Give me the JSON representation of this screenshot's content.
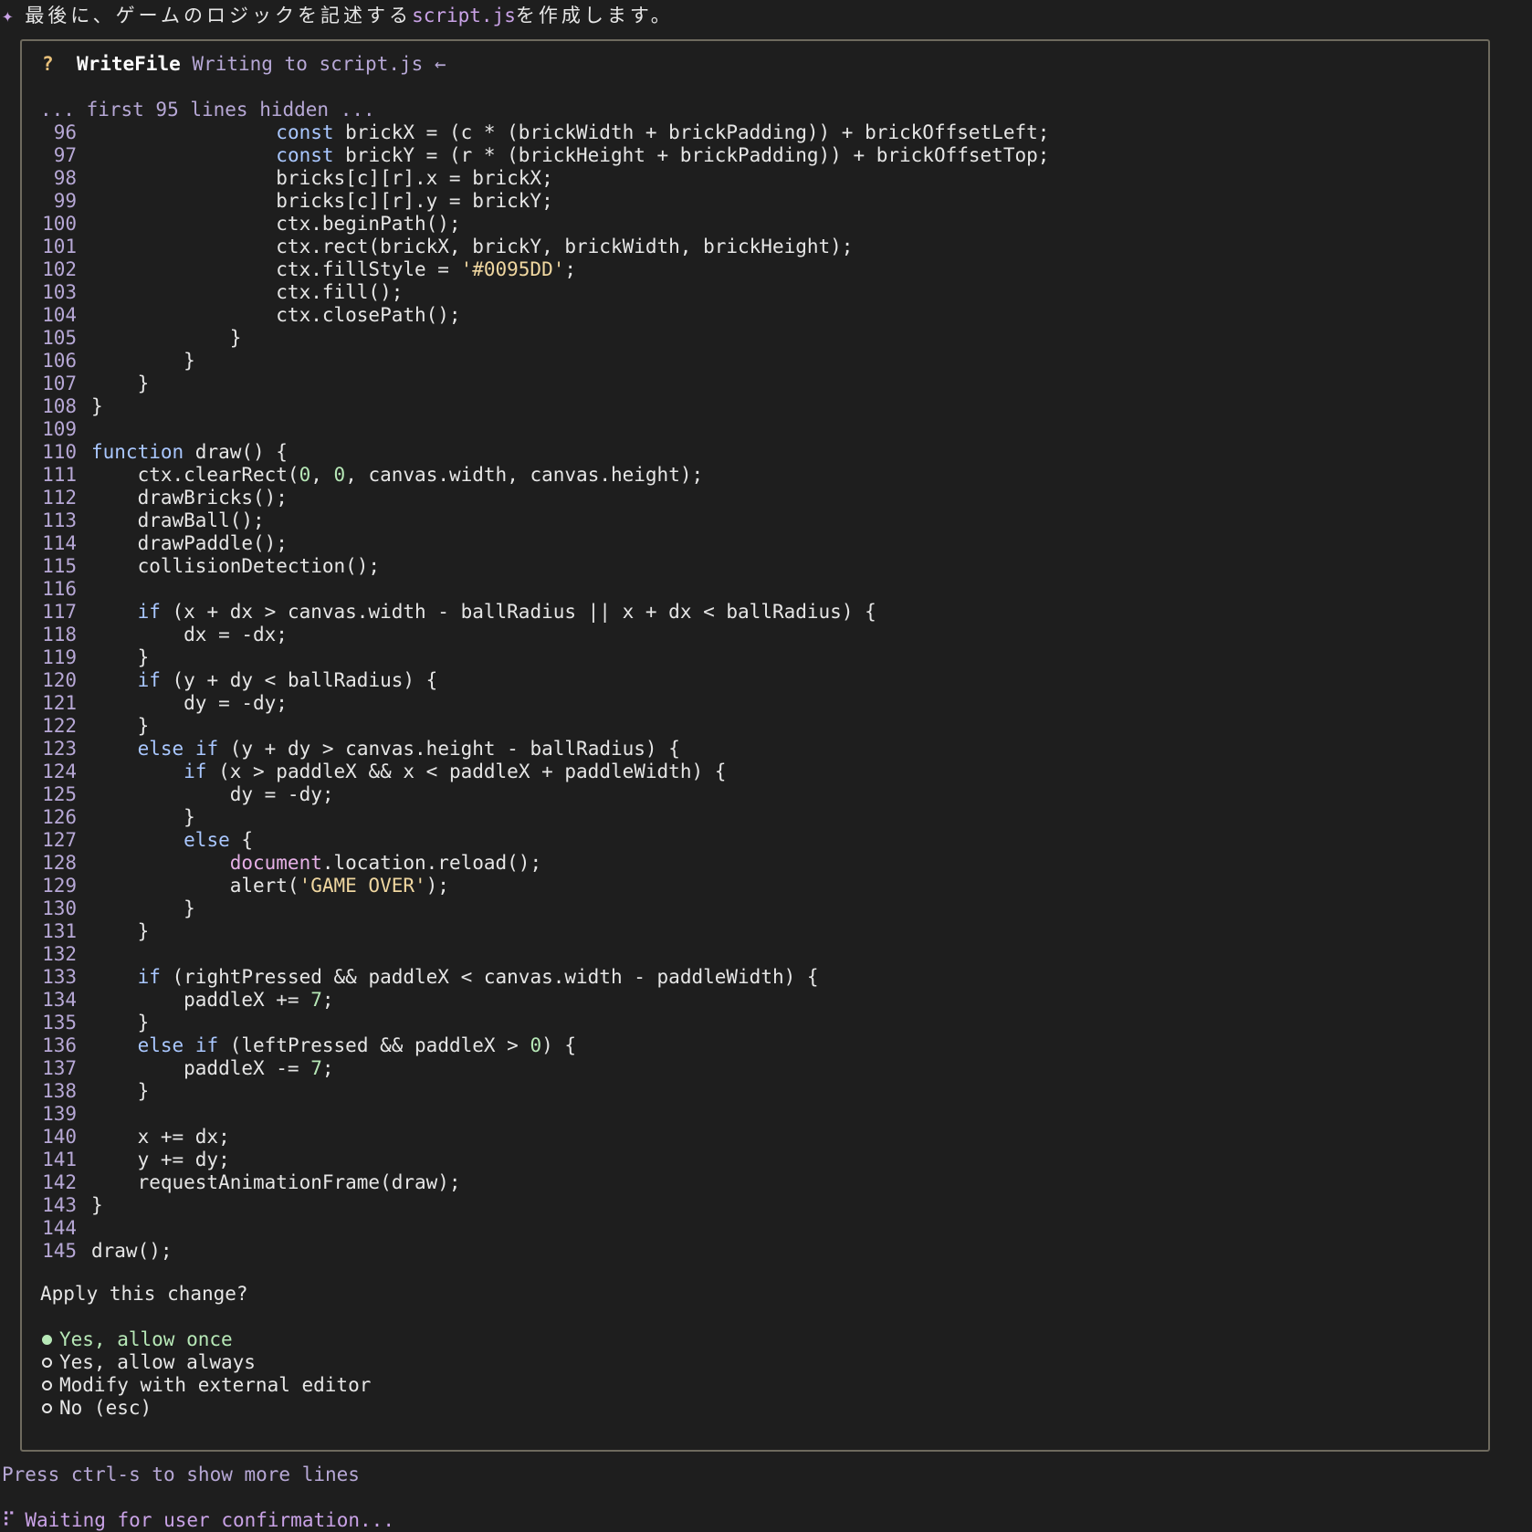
{
  "header": {
    "prefix": "最後に、ゲームのロジックを記述する",
    "file": "script.js",
    "suffix": "を作成します。"
  },
  "dialog": {
    "question_mark": "?",
    "tool_name": "WriteFile",
    "tool_desc": "Writing to script.js ←",
    "hidden_note": "... first 95 lines hidden ...",
    "apply_question": "Apply this change?",
    "options": [
      {
        "label": "Yes, allow once",
        "selected": true
      },
      {
        "label": "Yes, allow always",
        "selected": false
      },
      {
        "label": "Modify with external editor",
        "selected": false
      },
      {
        "label": "No (esc)",
        "selected": false
      }
    ]
  },
  "code_lines": [
    {
      "n": "96",
      "text": "                const brickX = (c * (brickWidth + brickPadding)) + brickOffsetLeft;"
    },
    {
      "n": "97",
      "text": "                const brickY = (r * (brickHeight + brickPadding)) + brickOffsetTop;"
    },
    {
      "n": "98",
      "text": "                bricks[c][r].x = brickX;"
    },
    {
      "n": "99",
      "text": "                bricks[c][r].y = brickY;"
    },
    {
      "n": "100",
      "text": "                ctx.beginPath();"
    },
    {
      "n": "101",
      "text": "                ctx.rect(brickX, brickY, brickWidth, brickHeight);"
    },
    {
      "n": "102",
      "text": "                ctx.fillStyle = '#0095DD';"
    },
    {
      "n": "103",
      "text": "                ctx.fill();"
    },
    {
      "n": "104",
      "text": "                ctx.closePath();"
    },
    {
      "n": "105",
      "text": "            }"
    },
    {
      "n": "106",
      "text": "        }"
    },
    {
      "n": "107",
      "text": "    }"
    },
    {
      "n": "108",
      "text": "}"
    },
    {
      "n": "109",
      "text": ""
    },
    {
      "n": "110",
      "text": "function draw() {"
    },
    {
      "n": "111",
      "text": "    ctx.clearRect(0, 0, canvas.width, canvas.height);"
    },
    {
      "n": "112",
      "text": "    drawBricks();"
    },
    {
      "n": "113",
      "text": "    drawBall();"
    },
    {
      "n": "114",
      "text": "    drawPaddle();"
    },
    {
      "n": "115",
      "text": "    collisionDetection();"
    },
    {
      "n": "116",
      "text": ""
    },
    {
      "n": "117",
      "text": "    if (x + dx > canvas.width - ballRadius || x + dx < ballRadius) {"
    },
    {
      "n": "118",
      "text": "        dx = -dx;"
    },
    {
      "n": "119",
      "text": "    }"
    },
    {
      "n": "120",
      "text": "    if (y + dy < ballRadius) {"
    },
    {
      "n": "121",
      "text": "        dy = -dy;"
    },
    {
      "n": "122",
      "text": "    }"
    },
    {
      "n": "123",
      "text": "    else if (y + dy > canvas.height - ballRadius) {"
    },
    {
      "n": "124",
      "text": "        if (x > paddleX && x < paddleX + paddleWidth) {"
    },
    {
      "n": "125",
      "text": "            dy = -dy;"
    },
    {
      "n": "126",
      "text": "        }"
    },
    {
      "n": "127",
      "text": "        else {"
    },
    {
      "n": "128",
      "text": "            document.location.reload();"
    },
    {
      "n": "129",
      "text": "            alert('GAME OVER');"
    },
    {
      "n": "130",
      "text": "        }"
    },
    {
      "n": "131",
      "text": "    }"
    },
    {
      "n": "132",
      "text": ""
    },
    {
      "n": "133",
      "text": "    if (rightPressed && paddleX < canvas.width - paddleWidth) {"
    },
    {
      "n": "134",
      "text": "        paddleX += 7;"
    },
    {
      "n": "135",
      "text": "    }"
    },
    {
      "n": "136",
      "text": "    else if (leftPressed && paddleX > 0) {"
    },
    {
      "n": "137",
      "text": "        paddleX -= 7;"
    },
    {
      "n": "138",
      "text": "    }"
    },
    {
      "n": "139",
      "text": ""
    },
    {
      "n": "140",
      "text": "    x += dx;"
    },
    {
      "n": "141",
      "text": "    y += dy;"
    },
    {
      "n": "142",
      "text": "    requestAnimationFrame(draw);"
    },
    {
      "n": "143",
      "text": "}"
    },
    {
      "n": "144",
      "text": ""
    },
    {
      "n": "145",
      "text": "draw();"
    }
  ],
  "footer": {
    "hint": "Press ctrl-s to show more lines",
    "status": "Waiting for user confirmation...",
    "spinner_char": "⠏",
    "sparkle_char": "✦"
  },
  "colors": {
    "background": "#1e1e1e",
    "keyword": "#a9c7ff",
    "string": "#f0d7a0",
    "number": "#b7e8b7",
    "accent": "#c9a2e6",
    "selected": "#b7e8b7"
  }
}
